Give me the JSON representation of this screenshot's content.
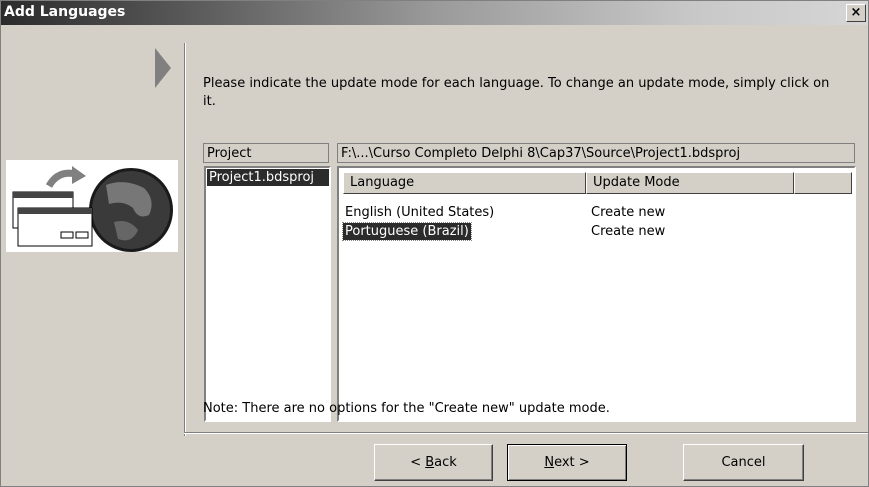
{
  "window": {
    "title": "Add Languages",
    "close_symbol": "×"
  },
  "instruction": "Please indicate the update mode for each language. To change an update mode, simply click on it.",
  "project_panel": {
    "header": "Project",
    "items": [
      "Project1.bdsproj"
    ]
  },
  "languages_panel": {
    "path": "F:\\...\\Curso Completo Delphi 8\\Cap37\\Source\\Project1.bdsproj",
    "columns": [
      "Language",
      "Update Mode"
    ],
    "rows": [
      {
        "language": "English (United States)",
        "mode": "Create new",
        "selected": false
      },
      {
        "language": "Portuguese (Brazil)",
        "mode": "Create new",
        "selected": true
      }
    ]
  },
  "note": "Note: There are no options for the \"Create new\" update mode.",
  "buttons": {
    "back": {
      "prefix": "< ",
      "accel": "B",
      "rest": "ack"
    },
    "next": {
      "accel": "N",
      "rest": "ext >"
    },
    "cancel": "Cancel"
  },
  "colors": {
    "selection": "#2b2b2b",
    "face": "#d4d0c8"
  },
  "icons": [
    "close-icon",
    "wizard-arrow-icon",
    "wizard-globe-image"
  ]
}
